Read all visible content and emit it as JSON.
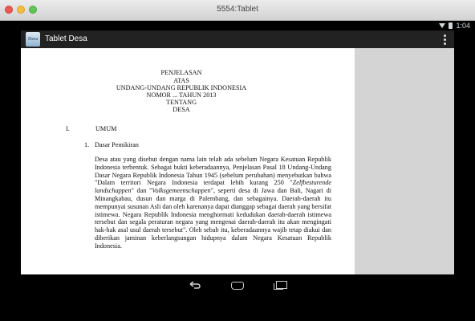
{
  "window": {
    "title": "5554:Tablet"
  },
  "status": {
    "time": "1:04"
  },
  "app": {
    "title": "Tablet Desa",
    "icon_label": "Desa",
    "icon": "app-logo-icon"
  },
  "document": {
    "heading_lines": [
      "PENJELASAN",
      "ATAS",
      "UNDANG-UNDANG REPUBLIK INDONESIA",
      "NOMOR ... TAHUN 2013",
      "TENTANG",
      "DESA"
    ],
    "section_number": "I.",
    "section_title": "UMUM",
    "subsection_number": "1.",
    "subsection_title": "Dasar Pemikiran",
    "paragraph": [
      {
        "t": "Desa atau yang disebut dengan nama lain telah ada sebelum Negara Kesatuan Republik Indonesia terbentuk. Sebagai bukti keberadaannya, Penjelasan Pasal 18 Undang-Undang Dasar Negara Republik Indonesia Tahun 1945 (sebelum perubahan) menyebutkan bahwa \"Dalam territori Negara Indonesia terdapat lebih kurang 250 \""
      },
      {
        "t": "Zelfbesturende landschappen",
        "i": true
      },
      {
        "t": "\" dan \""
      },
      {
        "t": "Volksgemeenschappen",
        "i": true
      },
      {
        "t": "\", seperti desa di Jawa dan Bali, Nagari di Minangkabau, dusun dan marga di Palembang, dan sebagainya. Daerah-daerah itu mempunyai  susunan Asli dan oleh karenanya dapat dianggap sebagai daerah yang bersifat istimewa. Negara Republik Indonesia menghormati kedudukan daerah-daerah istimewa tersebut dan segala peraturan negara yang mengenai daerah-daerah itu akan mengingati hak-hak asal usul daerah tersebut\". Oleh sebab itu, keberadaannya wajib tetap diakui dan diberikan jaminan keberlangsungan hidupnya dalam Negara Kesatuan Republik Indonesia."
      }
    ]
  }
}
